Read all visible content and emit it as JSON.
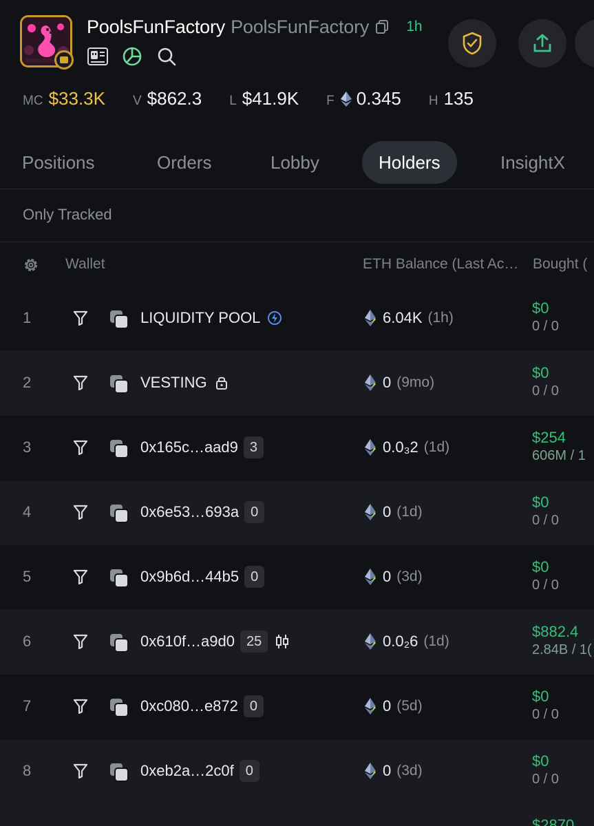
{
  "token": {
    "name": "PoolsFunFactory",
    "symbol": "PoolsFunFactory",
    "age": "1h"
  },
  "stats": [
    {
      "label": "MC",
      "value": "$33.3K",
      "color": "#f0c24a"
    },
    {
      "label": "V",
      "value": "$862.3"
    },
    {
      "label": "L",
      "value": "$41.9K"
    },
    {
      "label": "F",
      "value": "0.345",
      "icon": "eth-icon"
    },
    {
      "label": "H",
      "value": "135"
    }
  ],
  "tabs": [
    "Positions",
    "Orders",
    "Lobby",
    "Holders",
    "InsightX"
  ],
  "active_tab": "Holders",
  "filter": {
    "label": "Only Tracked"
  },
  "table": {
    "columns": [
      "Wallet",
      "ETH Balance (Last Ac…",
      "Bought ("
    ],
    "rows": [
      {
        "rank": "1",
        "wallet": "LIQUIDITY POOL",
        "badge": "",
        "tag_icon": "lightning-icon",
        "balance": "6.04K",
        "balance_time": "(1h)",
        "bought_usd": "$0",
        "bought_amt": "0 / 0"
      },
      {
        "rank": "2",
        "wallet": "VESTING",
        "badge": "",
        "tag_icon": "lock-icon",
        "balance": "0",
        "balance_time": "(9mo)",
        "bought_usd": "$0",
        "bought_amt": "0 / 0"
      },
      {
        "rank": "3",
        "wallet": "0x165c…aad9",
        "badge": "3",
        "tag_icon": "",
        "balance": "0.0₃2",
        "balance_time": "(1d)",
        "bought_usd": "$254",
        "bought_amt": "606M / 1"
      },
      {
        "rank": "4",
        "wallet": "0x6e53…693a",
        "badge": "0",
        "tag_icon": "",
        "balance": "0",
        "balance_time": "(1d)",
        "bought_usd": "$0",
        "bought_amt": "0 / 0"
      },
      {
        "rank": "5",
        "wallet": "0x9b6d…44b5",
        "badge": "0",
        "tag_icon": "",
        "balance": "0",
        "balance_time": "(3d)",
        "bought_usd": "$0",
        "bought_amt": "0 / 0"
      },
      {
        "rank": "6",
        "wallet": "0x610f…a9d0",
        "badge": "25",
        "tag_icon": "candlestick-icon",
        "balance": "0.0₂6",
        "balance_time": "(1d)",
        "bought_usd": "$882.4",
        "bought_amt": "2.84B / 1("
      },
      {
        "rank": "7",
        "wallet": "0xc080…e872",
        "badge": "0",
        "tag_icon": "",
        "balance": "0",
        "balance_time": "(5d)",
        "bought_usd": "$0",
        "bought_amt": "0 / 0"
      },
      {
        "rank": "8",
        "wallet": "0xeb2a…2c0f",
        "badge": "0",
        "tag_icon": "",
        "balance": "0",
        "balance_time": "(3d)",
        "bought_usd": "$0",
        "bought_amt": "0 / 0"
      }
    ],
    "partial_row": {
      "bought_usd": "$2870"
    }
  },
  "colors": {
    "positive": "#35c07a",
    "gold": "#f0c24a",
    "age": "#3ec48a"
  }
}
